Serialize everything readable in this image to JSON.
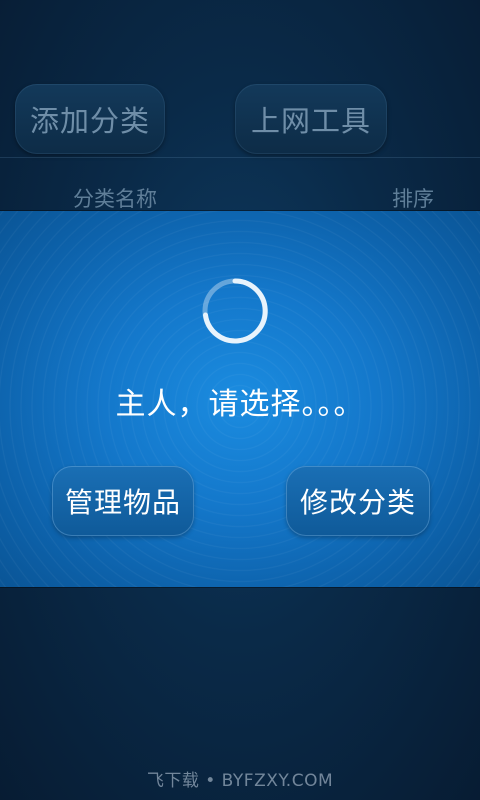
{
  "toolbar": {
    "add_category_label": "添加分类",
    "net_tools_label": "上网工具"
  },
  "list_header": {
    "name_label": "分类名称",
    "sort_label": "排序"
  },
  "dialog": {
    "spinner_icon": "loading-spinner-icon",
    "message": "主人，请选择。。。",
    "manage_items_label": "管理物品",
    "edit_category_label": "修改分类"
  },
  "watermark": {
    "text": "飞下载 • BYFZXY.COM"
  },
  "colors": {
    "dialog_blue": "#1478cb",
    "background_navy": "#0a2a48"
  }
}
